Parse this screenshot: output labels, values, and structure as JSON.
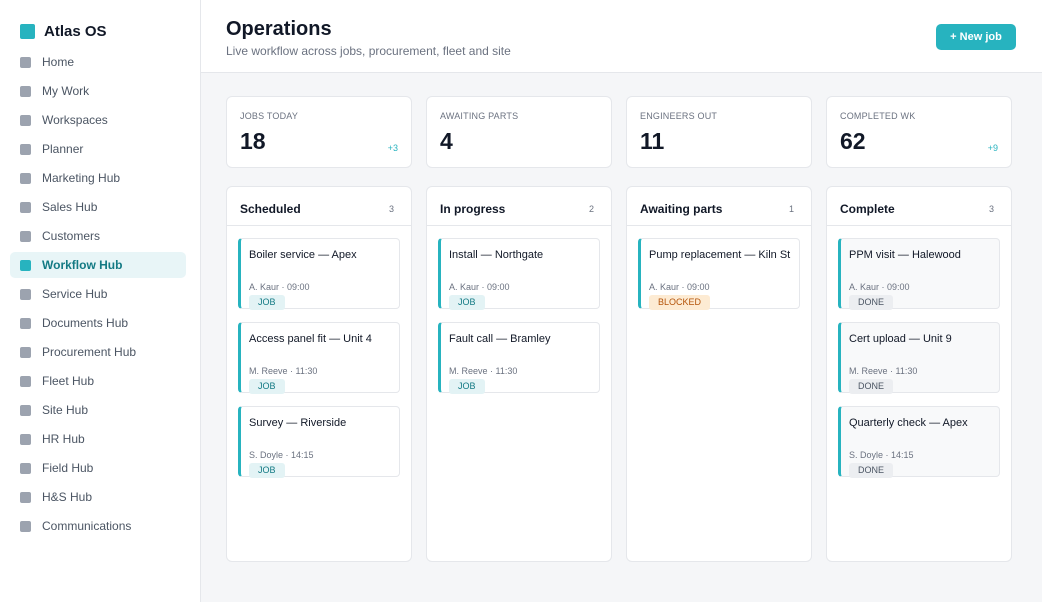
{
  "app": {
    "name": "Atlas OS",
    "accent": "#27b3bf"
  },
  "sidebar": {
    "items": [
      {
        "label": "Home",
        "active": false
      },
      {
        "label": "My Work",
        "active": false
      },
      {
        "label": "Workspaces",
        "active": false
      },
      {
        "label": "Planner",
        "active": false
      },
      {
        "label": "Marketing Hub",
        "active": false
      },
      {
        "label": "Sales Hub",
        "active": false
      },
      {
        "label": "Customers",
        "active": false
      },
      {
        "label": "Workflow Hub",
        "active": true
      },
      {
        "label": "Service Hub",
        "active": false
      },
      {
        "label": "Documents Hub",
        "active": false
      },
      {
        "label": "Procurement Hub",
        "active": false
      },
      {
        "label": "Fleet Hub",
        "active": false
      },
      {
        "label": "Site Hub",
        "active": false
      },
      {
        "label": "HR Hub",
        "active": false
      },
      {
        "label": "Field Hub",
        "active": false
      },
      {
        "label": "H&S Hub",
        "active": false
      },
      {
        "label": "Communications",
        "active": false
      }
    ]
  },
  "header": {
    "title": "Operations",
    "subtitle": "Live workflow across jobs, procurement, fleet and site",
    "new_job_label": "+ New job"
  },
  "stats": [
    {
      "label": "Jobs today",
      "value": "18",
      "delta": "+3"
    },
    {
      "label": "Awaiting parts",
      "value": "4",
      "delta": ""
    },
    {
      "label": "Engineers out",
      "value": "11",
      "delta": ""
    },
    {
      "label": "Completed wk",
      "value": "62",
      "delta": "+9"
    }
  ],
  "board": {
    "columns": [
      {
        "title": "Scheduled",
        "count": "3",
        "cards": [
          {
            "title": "Boiler service — Apex",
            "meta": "A. Kaur · 09:00",
            "tag": "JOB",
            "status": "job"
          },
          {
            "title": "Access panel fit — Unit 4",
            "meta": "M. Reeve · 11:30",
            "tag": "JOB",
            "status": "job"
          },
          {
            "title": "Survey — Riverside",
            "meta": "S. Doyle · 14:15",
            "tag": "JOB",
            "status": "job"
          }
        ]
      },
      {
        "title": "In progress",
        "count": "2",
        "cards": [
          {
            "title": "Install — Northgate",
            "meta": "A. Kaur · 09:00",
            "tag": "JOB",
            "status": "job"
          },
          {
            "title": "Fault call — Bramley",
            "meta": "M. Reeve · 11:30",
            "tag": "JOB",
            "status": "job"
          }
        ]
      },
      {
        "title": "Awaiting parts",
        "count": "1",
        "cards": [
          {
            "title": "Pump replacement — Kiln St",
            "meta": "A. Kaur · 09:00",
            "tag": "BLOCKED",
            "status": "blocked"
          }
        ]
      },
      {
        "title": "Complete",
        "count": "3",
        "cards": [
          {
            "title": "PPM visit — Halewood",
            "meta": "A. Kaur · 09:00",
            "tag": "DONE",
            "status": "done"
          },
          {
            "title": "Cert upload — Unit 9",
            "meta": "M. Reeve · 11:30",
            "tag": "DONE",
            "status": "done"
          },
          {
            "title": "Quarterly check — Apex",
            "meta": "S. Doyle · 14:15",
            "tag": "DONE",
            "status": "done"
          }
        ]
      }
    ]
  }
}
